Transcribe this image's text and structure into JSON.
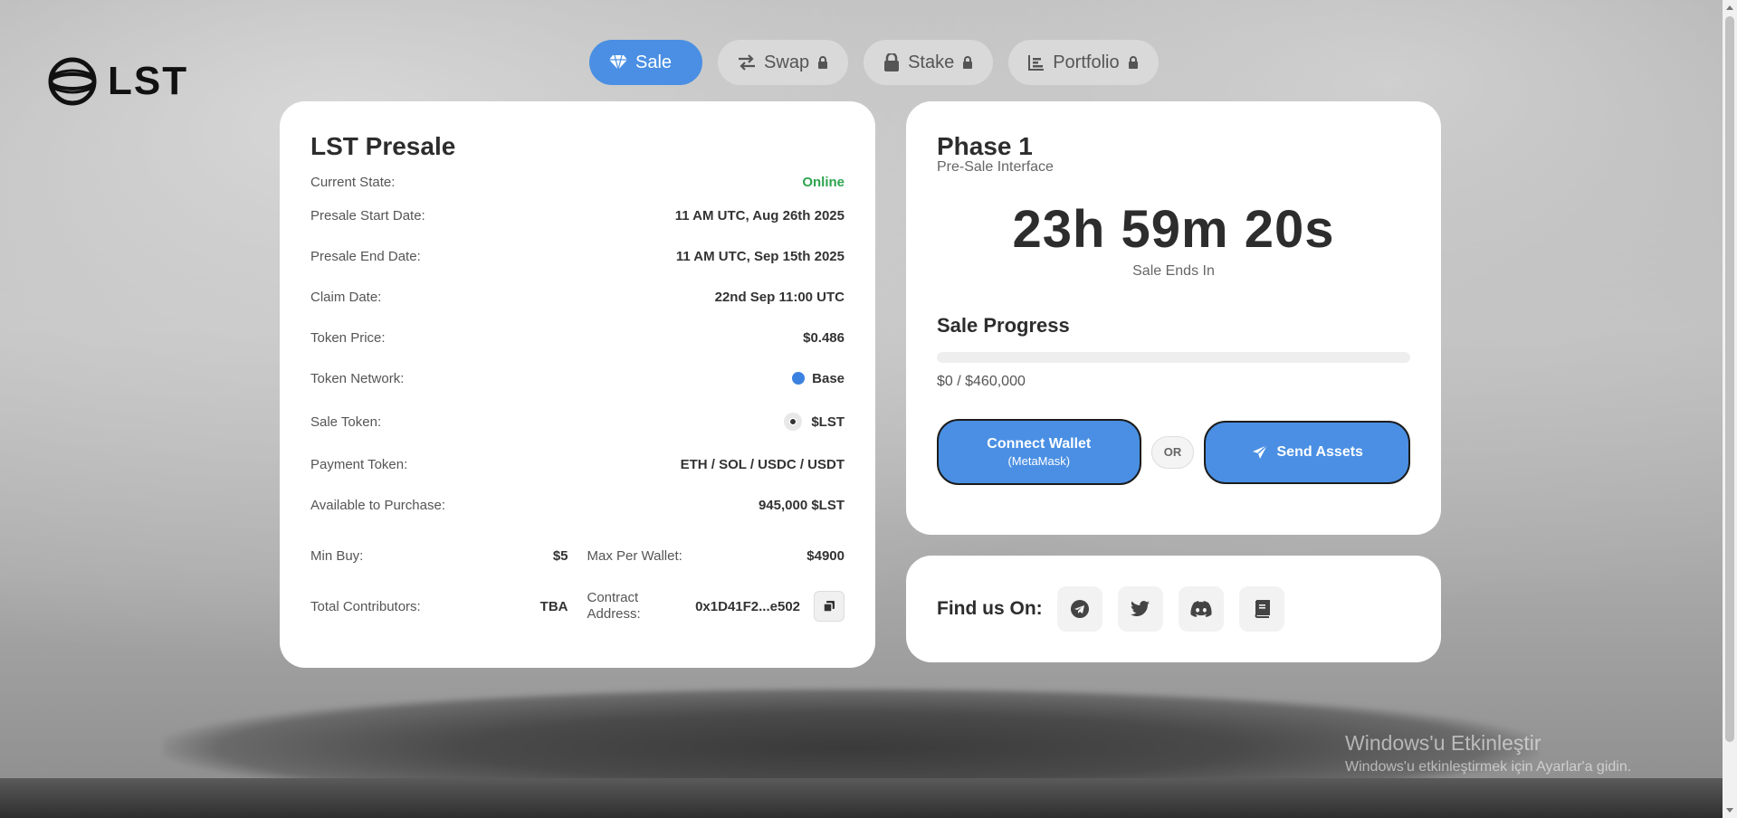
{
  "brand": {
    "name": "LST"
  },
  "nav": [
    {
      "label": "Sale",
      "icon": "diamond-icon",
      "locked": false,
      "active": true
    },
    {
      "label": "Swap",
      "icon": "swap-icon",
      "locked": true,
      "active": false
    },
    {
      "label": "Stake",
      "icon": "lock-icon",
      "locked": true,
      "active": false
    },
    {
      "label": "Portfolio",
      "icon": "chart-icon",
      "locked": true,
      "active": false
    }
  ],
  "presale": {
    "title": "LST Presale",
    "rows": [
      {
        "label": "Current State:",
        "value": "Online"
      },
      {
        "label": "Presale Start Date:",
        "value": "11 AM UTC, Aug 26th 2025"
      },
      {
        "label": "Presale End Date:",
        "value": "11 AM UTC, Sep 15th 2025"
      },
      {
        "label": "Claim Date:",
        "value": "22nd Sep 11:00 UTC"
      },
      {
        "label": "Token Price:",
        "value": "$0.486"
      },
      {
        "label": "Token Network:",
        "value": "Base"
      },
      {
        "label": "Sale Token:",
        "value": "$LST"
      },
      {
        "label": "Payment Token:",
        "value": "ETH / SOL / USDC / USDT"
      },
      {
        "label": "Available to Purchase:",
        "value": "945,000 $LST"
      }
    ],
    "min_buy_label": "Min Buy:",
    "min_buy_value": "$5",
    "max_wallet_label": "Max Per Wallet:",
    "max_wallet_value": "$4900",
    "contributors_label": "Total Contributors:",
    "contributors_value": "TBA",
    "contract_label": "Contract Address:",
    "contract_value": "0x1D41F2...e502"
  },
  "phase": {
    "title": "Phase 1",
    "subtitle": "Pre-Sale Interface",
    "countdown": "23h 59m 20s",
    "countdown_label": "Sale Ends In",
    "progress_title": "Sale Progress",
    "progress_fraction": 0,
    "progress_text": "$0 / $460,000",
    "connect_label": "Connect Wallet",
    "connect_sub": "(MetaMask)",
    "or_label": "OR",
    "send_label": "Send Assets"
  },
  "social": {
    "label": "Find us On:",
    "icons": [
      "telegram-icon",
      "twitter-icon",
      "discord-icon",
      "docs-icon"
    ]
  },
  "watermark": {
    "line1": "Windows'u Etkinleştir",
    "line2": "Windows'u etkinleştirmek için Ayarlar'a gidin."
  },
  "colors": {
    "accent": "#4a8fe3",
    "online": "#2ea44f",
    "network_dot": "#3b82e0"
  }
}
